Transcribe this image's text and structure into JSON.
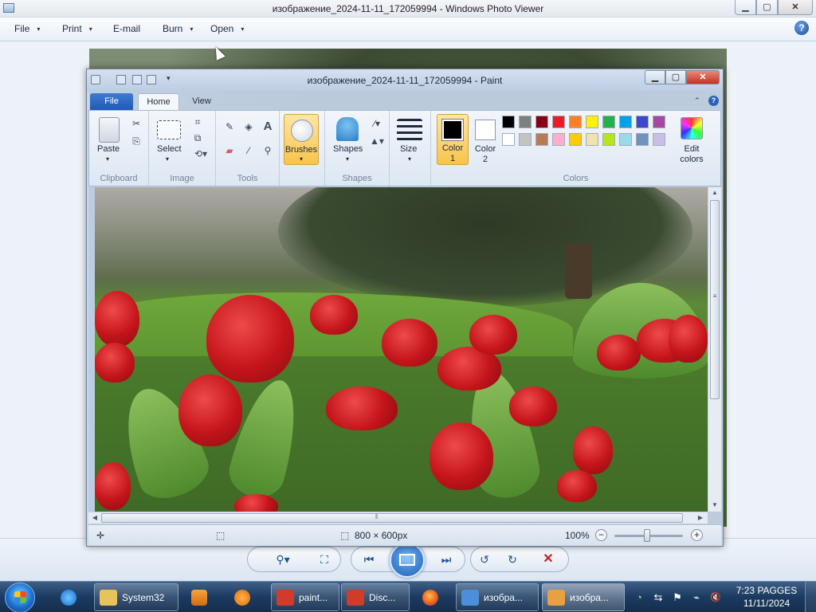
{
  "photo_viewer": {
    "title": "изображение_2024-11-11_172059994 - Windows Photo Viewer",
    "controls": {
      "minimize": "▁",
      "maximize": "▢",
      "close": "✕"
    },
    "menu": [
      {
        "label": "File",
        "has_arrow": true
      },
      {
        "label": "Print",
        "has_arrow": true
      },
      {
        "label": "E-mail",
        "has_arrow": false
      },
      {
        "label": "Burn",
        "has_arrow": true
      },
      {
        "label": "Open",
        "has_arrow": true
      }
    ],
    "help_icon": "question-circle-icon",
    "help_glyph": "?",
    "toolbar_glyphs": {
      "zoom": "⚲▾",
      "fit": "⛶",
      "previous": "⏮",
      "next": "⏭",
      "rotate_left": "↺",
      "rotate_right": "↻",
      "delete": "✕"
    }
  },
  "paint": {
    "title": "изображение_2024-11-11_172059994 - Paint",
    "controls": {
      "minimize": "▁",
      "maximize": "▢",
      "close": "✕"
    },
    "qat_arrow": "▾",
    "tabs": {
      "file": "File",
      "home": "Home",
      "view": "View"
    },
    "ribbon_glyphs": {
      "collapse": "⌃",
      "help": "?"
    },
    "groups": {
      "clipboard": "Clipboard",
      "image": "Image",
      "tools": "Tools",
      "shapes": "Shapes",
      "colors": "Colors"
    },
    "buttons": {
      "paste": "Paste",
      "select": "Select",
      "brushes": "Brushes",
      "shapes": "Shapes",
      "size": "Size",
      "color1_line1": "Color",
      "color1_line2": "1",
      "color2_line1": "Color",
      "color2_line2": "2",
      "edit_colors_line1": "Edit",
      "edit_colors_line2": "colors"
    },
    "dropdown_arrow": "▾",
    "tool_glyphs": {
      "cut": "✂",
      "copy": "⎘",
      "crop": "⌗",
      "resize": "⧉",
      "rotate": "⟲▾",
      "pencil": "✎",
      "fill": "◈",
      "text": "A",
      "eraser": "▰",
      "picker": "⁄",
      "magnifier": "⚲",
      "outline": "⁄▾",
      "fill_style": "▲▾"
    },
    "palette_row1": [
      "#000000",
      "#7f7f7f",
      "#880015",
      "#ed1c24",
      "#ff7f27",
      "#fff200",
      "#22b14c",
      "#00a2e8",
      "#3f48cc",
      "#a349a4"
    ],
    "palette_row2": [
      "#ffffff",
      "#c3c3c3",
      "#b97a57",
      "#ffaec9",
      "#ffc90e",
      "#efe4b0",
      "#b5e61d",
      "#99d9ea",
      "#7092be",
      "#c8bfe7"
    ],
    "color1": "#000000",
    "color2": "#ffffff",
    "scroll_glyphs": {
      "up": "▲",
      "down": "▼",
      "left": "◀",
      "right": "▶",
      "grip_v": "≡",
      "grip_h": "⦀"
    },
    "status": {
      "cursor_glyph": "✛",
      "selection_glyph": "⬚",
      "image_size_glyph": "⬚",
      "dimensions": "800 × 600px",
      "zoom": "100%",
      "zoom_level": 1.0,
      "zoom_out": "−",
      "zoom_in": "+"
    }
  },
  "taskbar": {
    "tasks": [
      {
        "label": "System32",
        "icon": "folder-icon",
        "color": "#e8c25a"
      },
      {
        "label": "paint...",
        "icon": "app-red-icon",
        "color": "#d23a2a"
      },
      {
        "label": "Disc...",
        "icon": "app-red-icon",
        "color": "#d23a2a"
      },
      {
        "label": "изобра...",
        "icon": "photo-viewer-icon",
        "color": "#4a8fd8"
      },
      {
        "label": "изобра...",
        "icon": "paint-icon",
        "color": "#e9a040"
      }
    ],
    "tray_glyphs": {
      "network": "⇆",
      "flag": "⚑",
      "power": "⌁",
      "volume": "🔇",
      "security": "◔"
    },
    "clock_time": "7:23 PAGGES",
    "clock_date": "11/11/2024"
  }
}
